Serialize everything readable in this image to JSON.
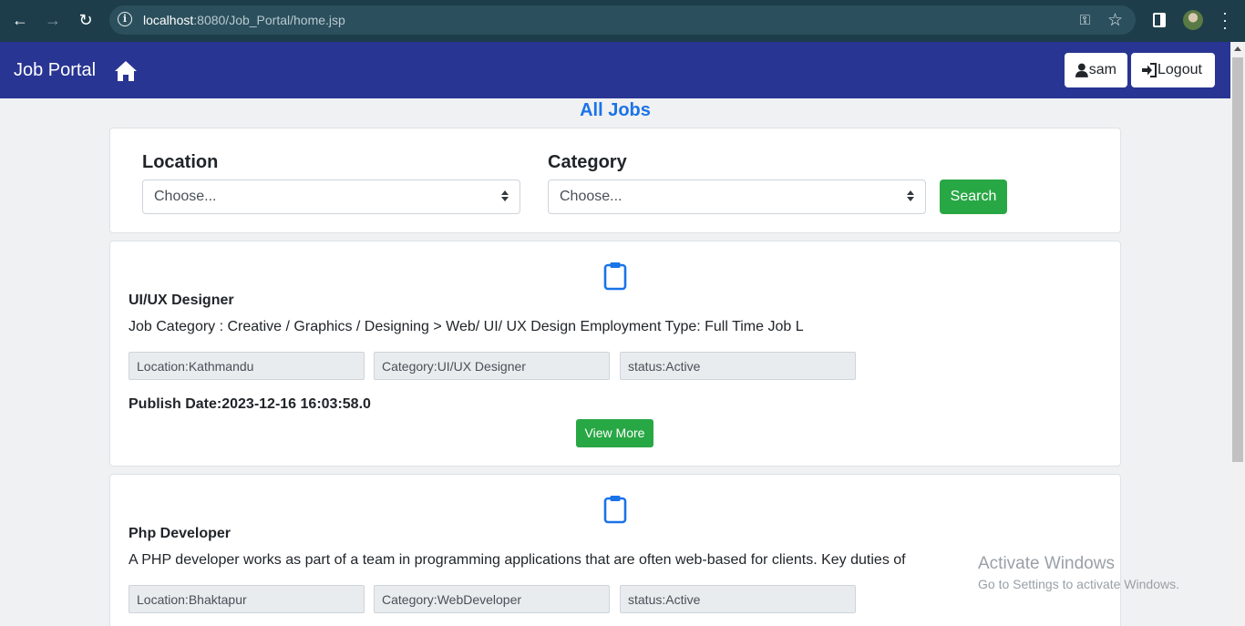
{
  "browser": {
    "url_host": "localhost",
    "url_rest": ":8080/Job_Portal/home.jsp",
    "icons": [
      "back-arrow-icon",
      "forward-arrow-icon",
      "reload-icon",
      "info-icon",
      "key-icon",
      "star-icon",
      "side-panel-icon",
      "profile-icon",
      "menu-icon"
    ]
  },
  "navbar": {
    "brand": "Job Portal",
    "user_label": "sam",
    "logout_label": "Logout",
    "color": "#283593"
  },
  "page": {
    "title": "All Jobs"
  },
  "search": {
    "location_label": "Location",
    "location_value": "Choose...",
    "category_label": "Category",
    "category_value": "Choose...",
    "button_label": "Search"
  },
  "jobs": [
    {
      "title": "UI/UX Designer",
      "description": "Job Category : Creative / Graphics / Designing > Web/ UI/ UX Design Employment Type: Full Time Job L",
      "location": "Location:Kathmandu",
      "category": "Category:UI/UX Designer",
      "status": "status:Active",
      "publish_date": "Publish Date:2023-12-16 16:03:58.0",
      "view_more": "View More"
    },
    {
      "title": "Php Developer",
      "description": "A PHP developer works as part of a team in programming applications that are often web-based for clients. Key duties of",
      "location": "Location:Bhaktapur",
      "category": "Category:WebDeveloper",
      "status": "status:Active"
    }
  ],
  "watermark": {
    "line1": "Activate Windows",
    "line2": "Go to Settings to activate Windows."
  },
  "colors": {
    "accent_blue": "#1a73e8",
    "success_green": "#28a745",
    "chrome_bar": "#1d3d4a"
  }
}
